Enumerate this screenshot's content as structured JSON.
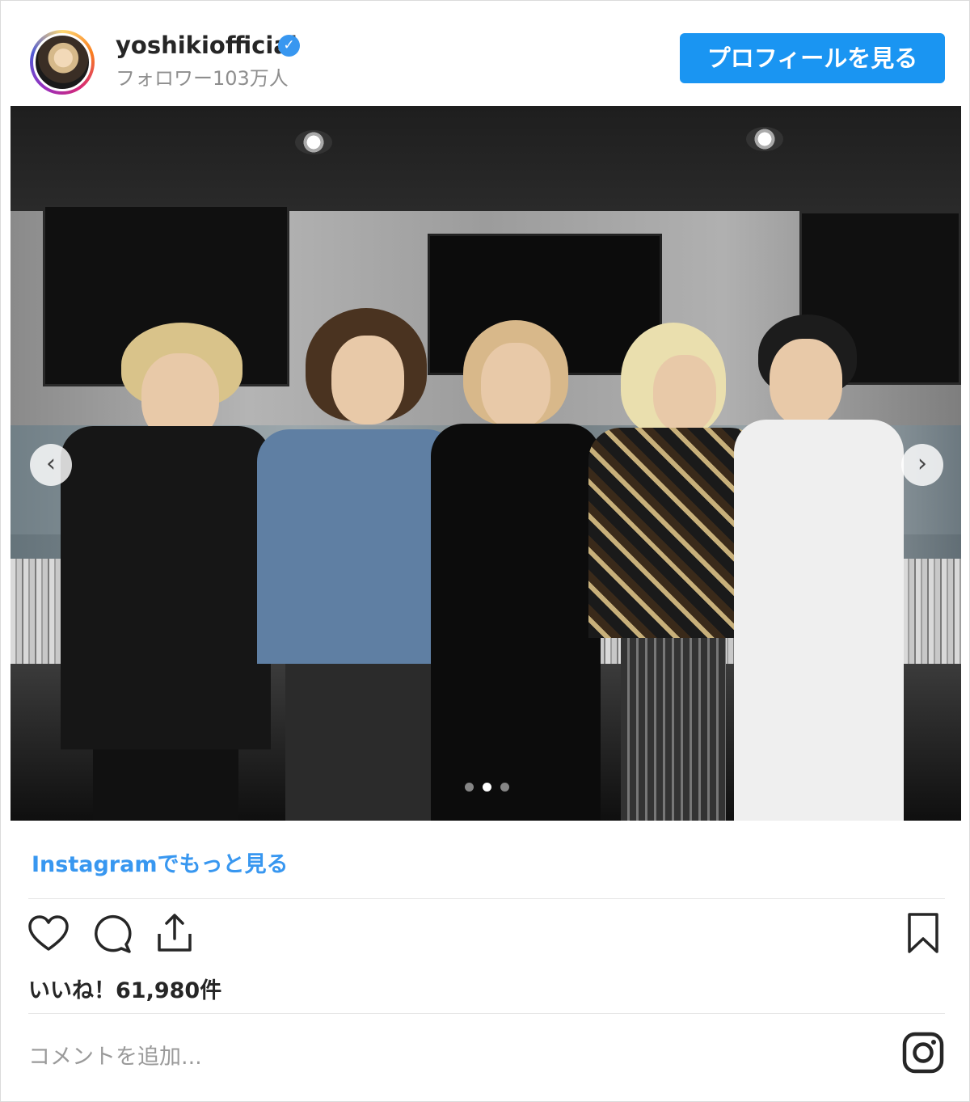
{
  "post": {
    "username": "yoshikiofficial",
    "verified_mark": "✓",
    "followers": "フォロワー103万人",
    "profile_button": "プロフィールを見る",
    "more_link": "Instagramでもっと見る",
    "likes": "いいね！61,980件",
    "comment_placeholder": "コメントを追加..."
  },
  "carousel": {
    "prev_arrow": "‹",
    "next_arrow": "›",
    "current_index": 2,
    "total": 3
  },
  "icons": {
    "like": "heart-icon",
    "comment": "comment-icon",
    "share": "share-icon",
    "save": "bookmark-icon",
    "brand": "instagram-icon"
  },
  "colors": {
    "accent": "#3897f0",
    "button": "#1a95f2",
    "muted": "#8e8e8e"
  }
}
